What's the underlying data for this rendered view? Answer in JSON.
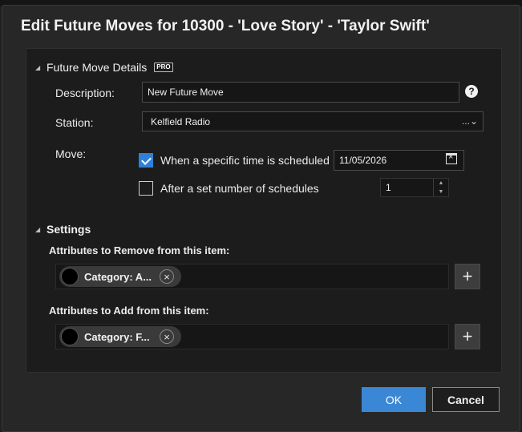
{
  "dialog": {
    "title": "Edit Future Moves for 10300 - 'Love Story' - 'Taylor Swift'"
  },
  "future_move_details": {
    "heading": "Future Move Details",
    "badge": "PRO",
    "description_label": "Description:",
    "description_value": "New Future Move",
    "help_symbol": "?",
    "station_label": "Station:",
    "station_value": "Kelfield Radio",
    "station_more": "...",
    "move_label": "Move:",
    "option_time_label": "When a specific time is scheduled",
    "option_time_checked": true,
    "option_time_date": "11/05/2026",
    "option_count_label": "After a set number of schedules",
    "option_count_checked": false,
    "option_count_value": "1"
  },
  "settings": {
    "heading": "Settings",
    "remove_label": "Attributes to Remove from this item:",
    "remove_chip": "Category: A...",
    "add_label": "Attributes to Add from this item:",
    "add_chip": "Category: F..."
  },
  "buttons": {
    "ok": "OK",
    "cancel": "Cancel"
  },
  "icons": {
    "collapse": "triangle-down-icon",
    "help": "help-icon",
    "calendar": "calendar-icon",
    "close": "close-icon",
    "add": "plus-icon"
  },
  "colors": {
    "accent": "#3a87d6",
    "checkbox": "#2f80d8",
    "background": "#272727",
    "panel": "#1c1c1c"
  }
}
